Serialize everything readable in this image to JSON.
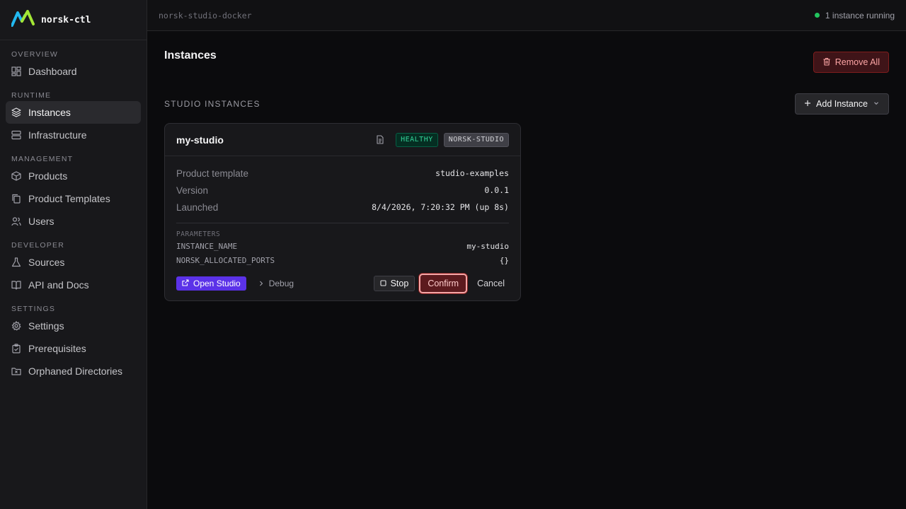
{
  "brand": {
    "name": "norsk-ctl",
    "icon": "norsk-logo-icon"
  },
  "sidebar": {
    "sections": [
      {
        "label": "OVERVIEW",
        "items": [
          {
            "label": "Dashboard",
            "icon": "dashboard-icon"
          }
        ]
      },
      {
        "label": "RUNTIME",
        "items": [
          {
            "label": "Instances",
            "icon": "layers-icon",
            "active": true
          },
          {
            "label": "Infrastructure",
            "icon": "server-icon"
          }
        ]
      },
      {
        "label": "MANAGEMENT",
        "items": [
          {
            "label": "Products",
            "icon": "box-icon"
          },
          {
            "label": "Product Templates",
            "icon": "copy-icon"
          },
          {
            "label": "Users",
            "icon": "users-icon"
          }
        ]
      },
      {
        "label": "DEVELOPER",
        "items": [
          {
            "label": "Sources",
            "icon": "flask-icon"
          },
          {
            "label": "API and Docs",
            "icon": "book-icon"
          }
        ]
      },
      {
        "label": "SETTINGS",
        "items": [
          {
            "label": "Settings",
            "icon": "gear-icon"
          },
          {
            "label": "Prerequisites",
            "icon": "clipboard-check-icon"
          },
          {
            "label": "Orphaned Directories",
            "icon": "folder-x-icon"
          }
        ]
      }
    ]
  },
  "topbar": {
    "environment": "norsk-studio-docker",
    "status": "1 instance running",
    "status_color": "#22c55e"
  },
  "page": {
    "title": "Instances",
    "remove_all_label": "Remove All",
    "section_label": "STUDIO INSTANCES",
    "add_instance_label": "Add Instance"
  },
  "card": {
    "name": "my-studio",
    "health_badge": "HEALTHY",
    "product_badge": "NORSK-STUDIO",
    "fields": [
      {
        "key": "Product template",
        "value": "studio-examples"
      },
      {
        "key": "Version",
        "value": "0.0.1"
      },
      {
        "key": "Launched",
        "value": "8/4/2026, 7:20:32 PM (up 8s)"
      }
    ],
    "parameters_label": "PARAMETERS",
    "parameters": [
      {
        "key": "INSTANCE_NAME",
        "value": "my-studio"
      },
      {
        "key": "NORSK_ALLOCATED_PORTS",
        "value": "{}"
      }
    ],
    "actions": {
      "open_studio": "Open Studio",
      "debug": "Debug",
      "stop": "Stop",
      "confirm": "Confirm",
      "cancel": "Cancel"
    }
  },
  "colors": {
    "accent": "#5b32e8",
    "danger": "#7f1d1d",
    "healthy": "#34d399"
  }
}
